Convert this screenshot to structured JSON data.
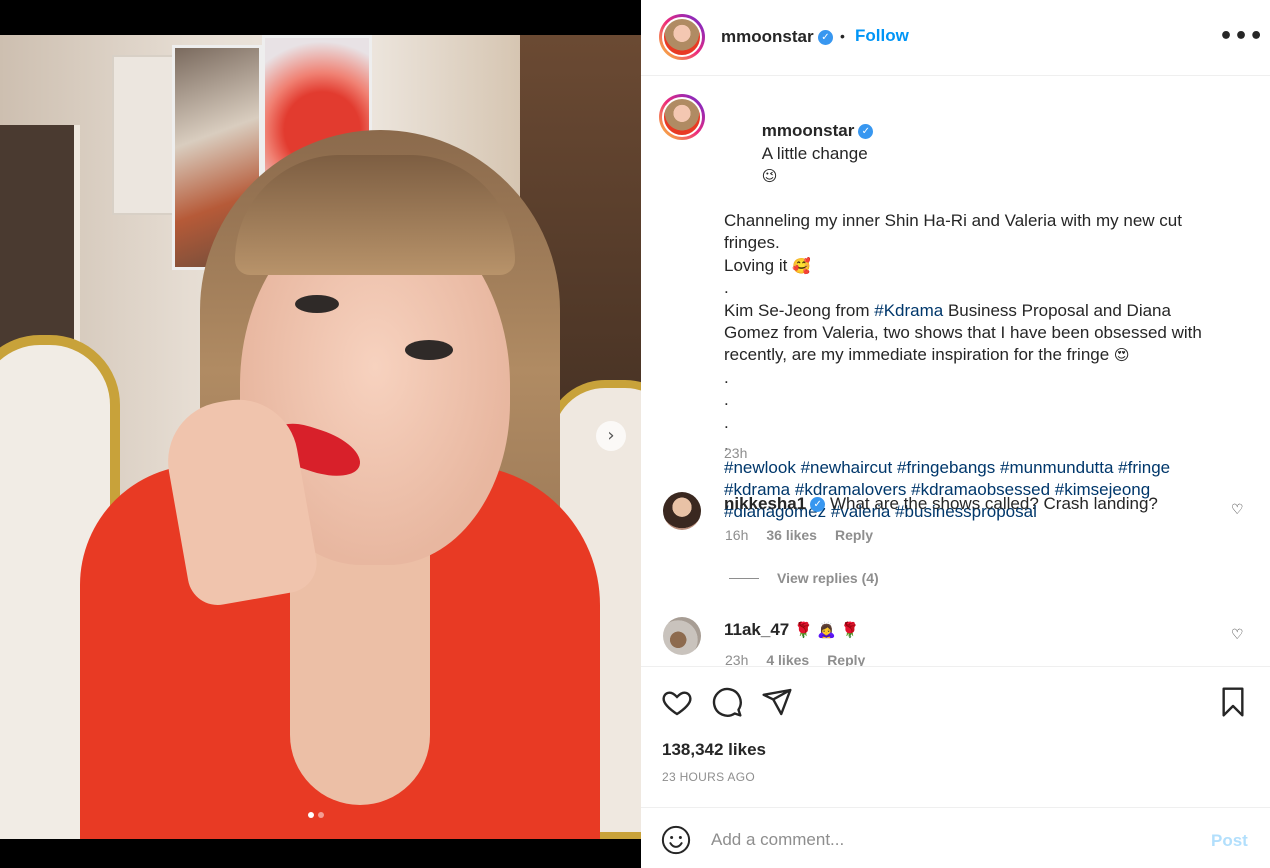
{
  "post": {
    "username": "mmoonstar",
    "follow_label": "Follow",
    "separator": "•",
    "more_icon": "more-horizontal-icon",
    "more_label": "•••"
  },
  "caption": {
    "username": "mmoonstar",
    "first_line": "A little change",
    "lines": [
      "Channeling my inner Shin Ha-Ri and Valeria with my new cut fringes.",
      "Loving it",
      ".",
      "Kim Se-Jeong from ",
      ".",
      ".",
      ".",
      "."
    ],
    "line4_tag": "#Kdrama",
    "line4_rest": " Business Proposal and Diana Gomez from Valeria, two shows that I have been obsessed with recently, are my immediate inspiration for the fringe",
    "hashtags": [
      "#newlook",
      "#newhaircut",
      "#fringebangs",
      "#munmundutta",
      "#fringe",
      "#kdrama",
      "#kdramalovers",
      "#kdramaobsessed",
      "#kimsejeong",
      "#dianagomez",
      "#valeria",
      "#businessproposal"
    ],
    "time": "23h"
  },
  "comments": [
    {
      "username": "nikkesha1",
      "verified": true,
      "text": "What are the shows called? Crash landing?",
      "time": "16h",
      "likes": "36 likes",
      "reply_label": "Reply",
      "view_replies": "View replies (4)"
    },
    {
      "username": "11ak_47",
      "verified": false,
      "text": "🌹 🙇‍♀️ 🌹",
      "time": "23h",
      "likes": "4 likes",
      "reply_label": "Reply"
    }
  ],
  "actions": {
    "likes": "138,342 likes",
    "timestamp": "23 HOURS AGO"
  },
  "add_comment": {
    "placeholder": "Add a comment...",
    "post_label": "Post"
  },
  "media": {
    "next_label": "›",
    "dots_total": 2,
    "dots_active": 1
  },
  "colors": {
    "accent": "#0095f6",
    "verified": "#3897f0",
    "hashtag": "#00376b",
    "muted": "#8e8e8e",
    "post_disabled": "#b2dffc"
  }
}
